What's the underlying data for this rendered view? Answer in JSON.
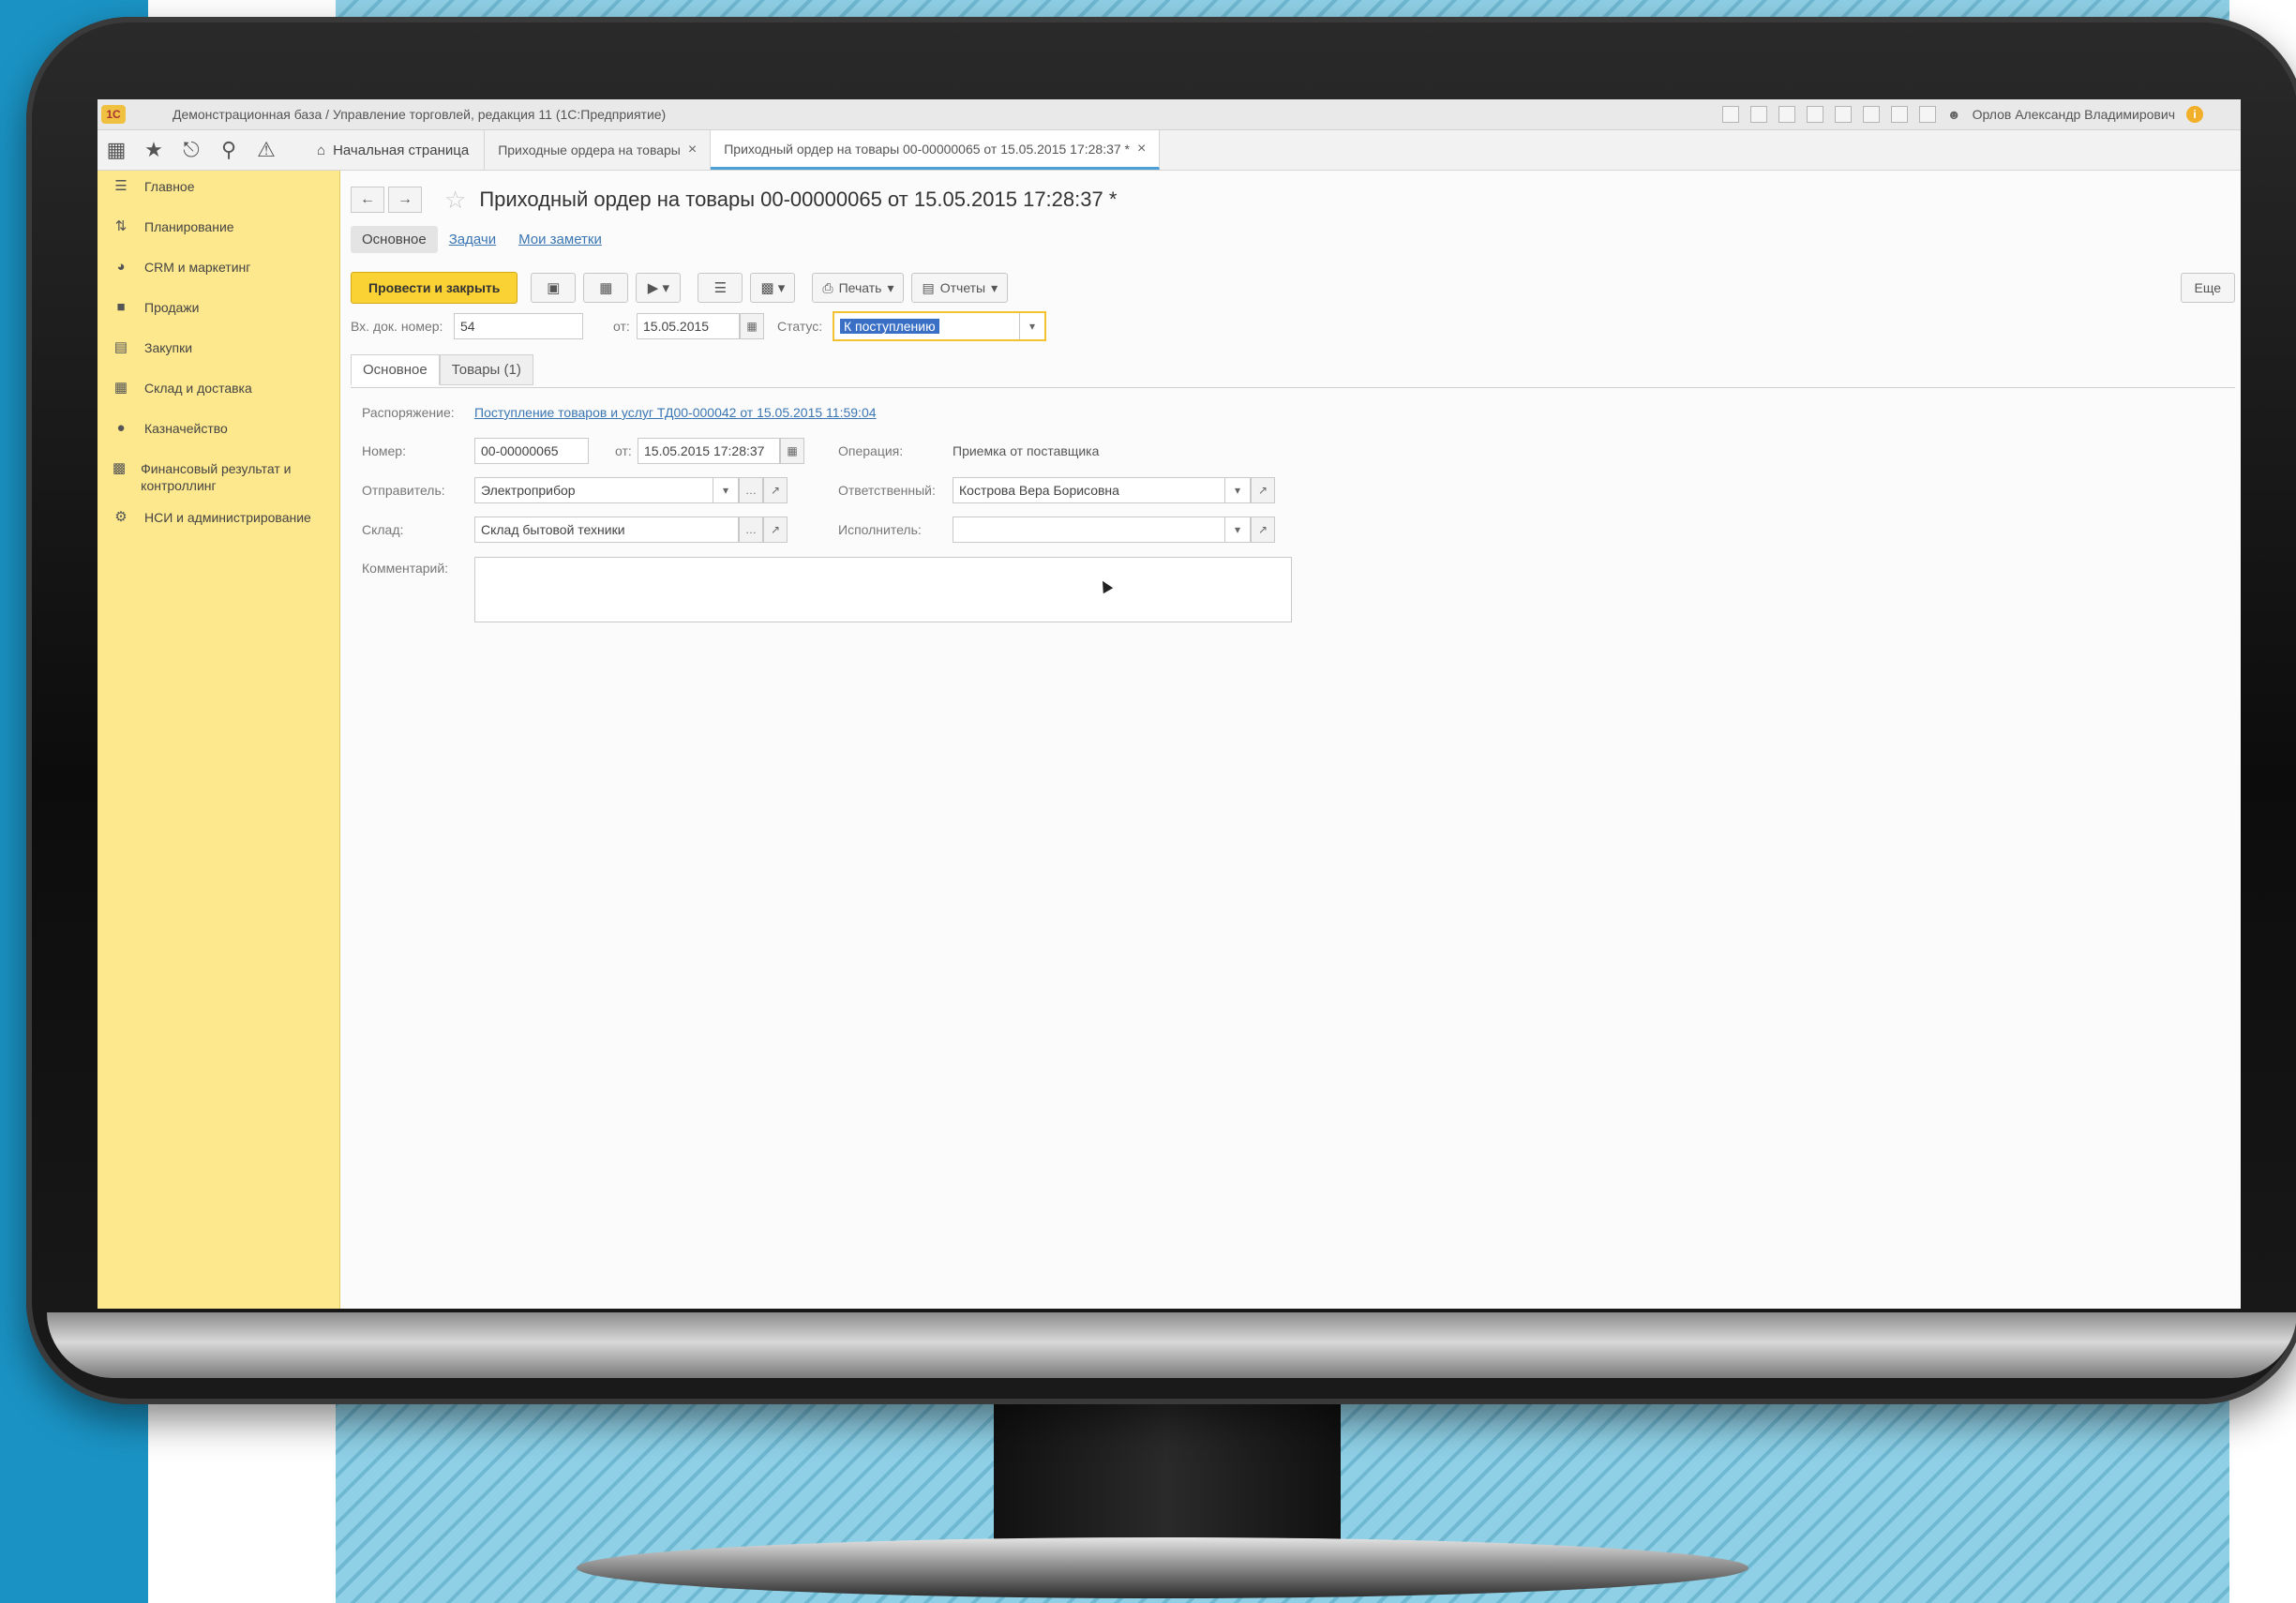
{
  "window": {
    "title": "Демонстрационная база / Управление торговлей, редакция 11 (1С:Предприятие)",
    "user": "Орлов Александр Владимирович"
  },
  "navbar": {
    "home_tab": "Начальная страница",
    "tabs": [
      {
        "label": "Приходные ордера на товары"
      },
      {
        "label": "Приходный ордер на товары 00-00000065 от 15.05.2015 17:28:37 *"
      }
    ]
  },
  "sidebar": {
    "items": [
      {
        "label": "Главное",
        "icon": "menu-lines-icon"
      },
      {
        "label": "Планирование",
        "icon": "planning-icon"
      },
      {
        "label": "CRM и маркетинг",
        "icon": "crm-icon"
      },
      {
        "label": "Продажи",
        "icon": "bag-icon"
      },
      {
        "label": "Закупки",
        "icon": "cart-icon"
      },
      {
        "label": "Склад и доставка",
        "icon": "warehouse-icon"
      },
      {
        "label": "Казначейство",
        "icon": "treasury-icon"
      },
      {
        "label": "Финансовый результат и контроллинг",
        "icon": "chart-icon"
      },
      {
        "label": "НСИ и администрирование",
        "icon": "gear-icon"
      }
    ]
  },
  "document": {
    "title": "Приходный ордер на товары 00-00000065 от 15.05.2015 17:28:37 *",
    "subtabs": [
      "Основное",
      "Задачи",
      "Мои заметки"
    ],
    "toolbar": {
      "post_close": "Провести и закрыть",
      "print": "Печать",
      "reports": "Отчеты",
      "more": "Еще"
    },
    "header_fields": {
      "incoming_no_label": "Вх. док. номер:",
      "incoming_no": "54",
      "from_label": "от:",
      "from_date": "15.05.2015",
      "status_label": "Статус:",
      "status": "К поступлению"
    },
    "inner_tabs": [
      "Основное",
      "Товары (1)"
    ],
    "order_label": "Распоряжение:",
    "order_link": "Поступление товаров и услуг ТД00-000042 от 15.05.2015 11:59:04",
    "number_label": "Номер:",
    "number": "00-00000065",
    "date_label": "от:",
    "date": "15.05.2015 17:28:37",
    "operation_label": "Операция:",
    "operation": "Приемка от поставщика",
    "sender_label": "Отправитель:",
    "sender": "Электроприбор",
    "responsible_label": "Ответственный:",
    "responsible": "Кострова Вера Борисовна",
    "warehouse_label": "Склад:",
    "warehouse": "Склад бытовой техники",
    "executor_label": "Исполнитель:",
    "executor": "",
    "comment_label": "Комментарий:",
    "comment": ""
  },
  "colors": {
    "sidebar_bg": "#fde88d",
    "primary_button": "#fbd233",
    "link": "#3a76b3",
    "backdrop_blue": "#1a93c4"
  }
}
